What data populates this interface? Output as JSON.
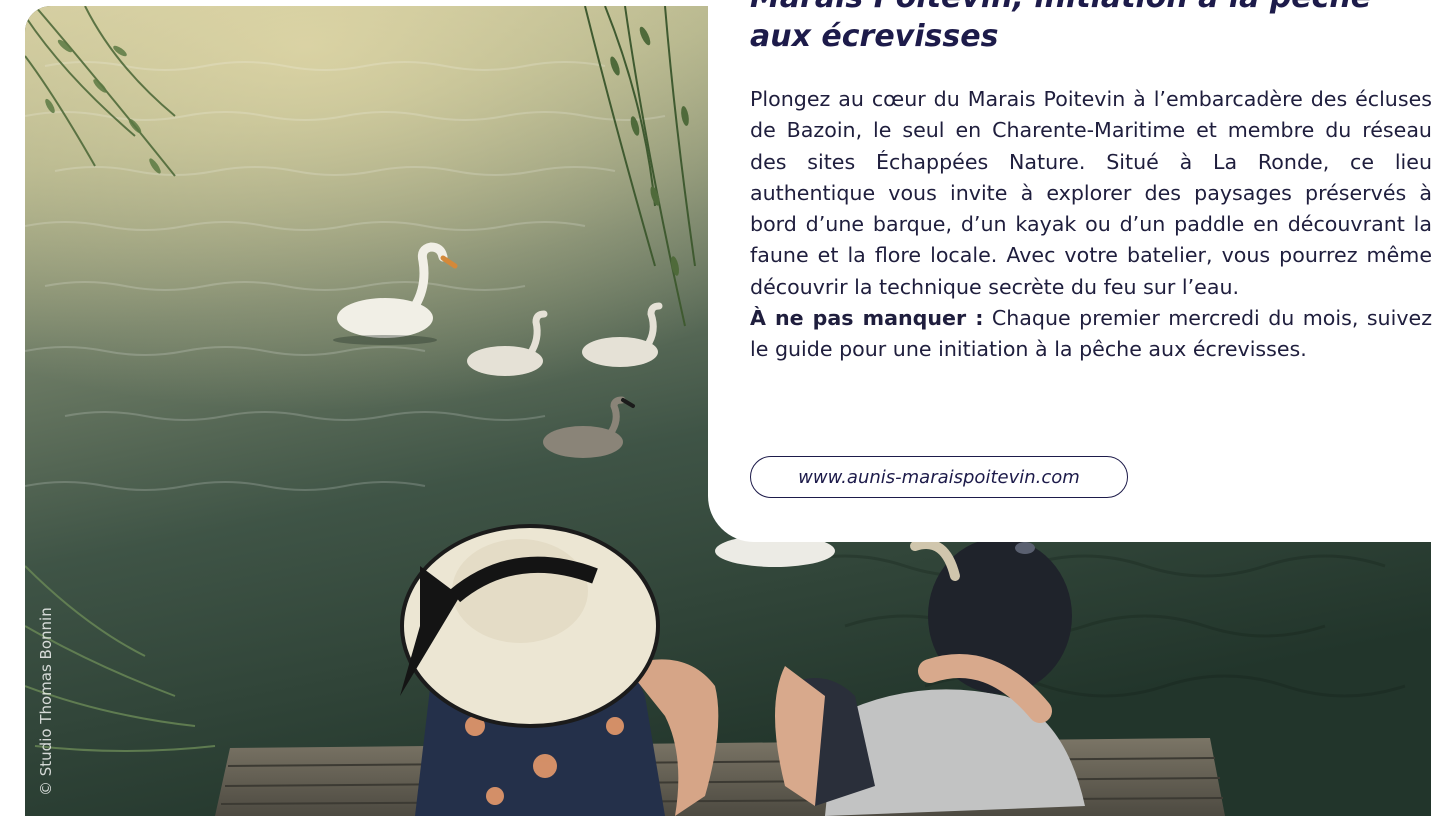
{
  "article": {
    "title": "Marais Poitevin, initiation à la pêche aux écrevisses",
    "paragraph": "Plongez au cœur du Marais Poitevin à l’embarcadère des écluses de Bazoin, le seul en Charente-Maritime et membre du réseau des sites Échappées Nature. Situé à La Ronde, ce lieu authentique vous invite à explorer des paysages préservés à bord d’une barque, d’un kayak ou d’un paddle en découvrant la faune et la flore locale. Avec votre batelier, vous pourrez même découvrir la technique secrète du feu sur l’eau.",
    "highlight_label": "À ne pas manquer :",
    "highlight_text": " Chaque premier mercredi du mois, suivez le guide pour une initiation à la pêche aux écrevisses.",
    "website": "www.aunis-maraispoitevin.com"
  },
  "photo": {
    "credit": "© Studio Thomas Bonnin",
    "subject": "swans-on-water-with-couple-on-dock"
  },
  "colors": {
    "text_navy": "#1d1b4a",
    "card_background": "#ffffff"
  }
}
